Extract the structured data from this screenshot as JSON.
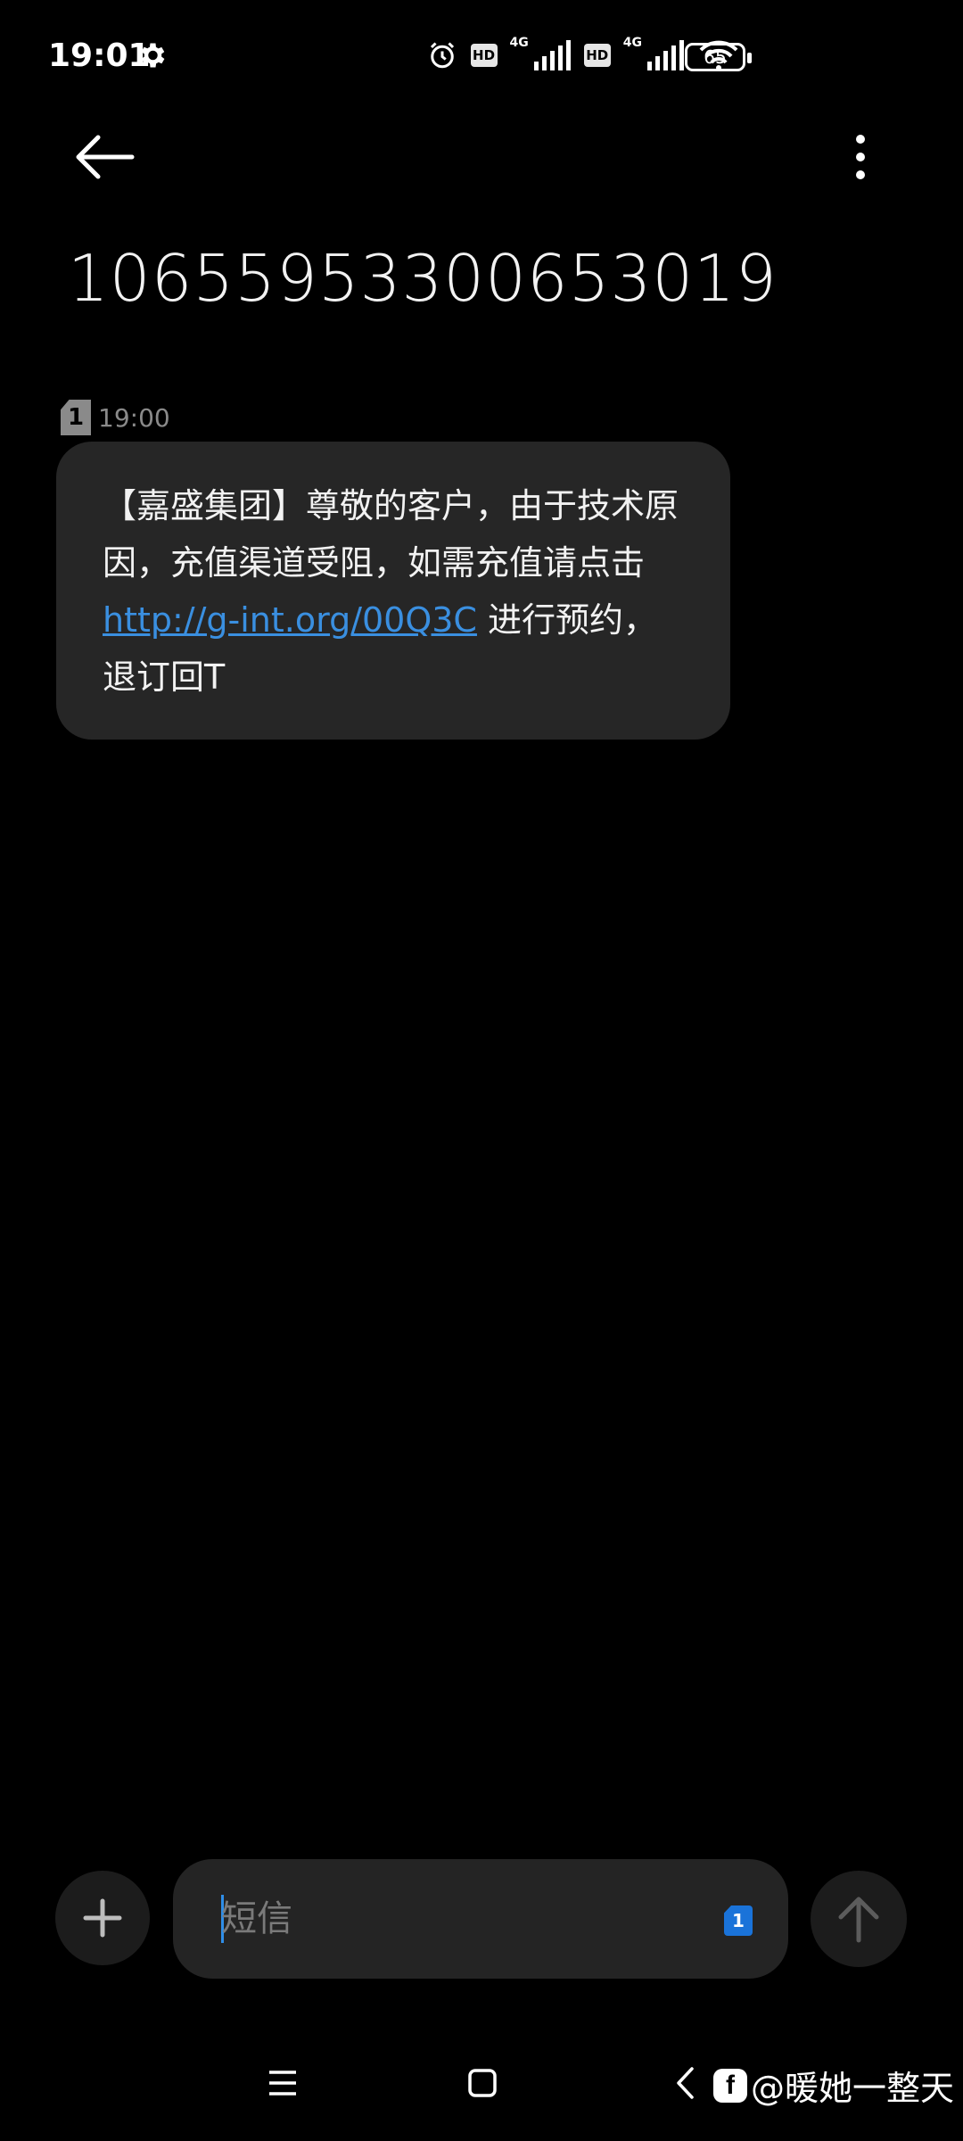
{
  "status_bar": {
    "time": "19:01",
    "hd": "HD",
    "net": "4G",
    "battery": "65"
  },
  "header": {
    "title": "10655953300653019",
    "menu_icon": "more-vert-icon",
    "back_icon": "arrow-left-icon"
  },
  "message": {
    "sim": "1",
    "time": "19:00",
    "text_before": "【嘉盛集团】尊敬的客户，由于技术原因，充值渠道受阻，如需充值请点击",
    "link": "http://g-int.org/00Q3C",
    "text_after": " 进行预约，退订回T"
  },
  "compose": {
    "placeholder": "短信",
    "sim": "1"
  },
  "watermark": {
    "text": "@暖她一整天"
  },
  "colors": {
    "background": "#000000",
    "bubble": "#262626",
    "link": "#3a8fe0",
    "accent": "#1a73d9"
  }
}
